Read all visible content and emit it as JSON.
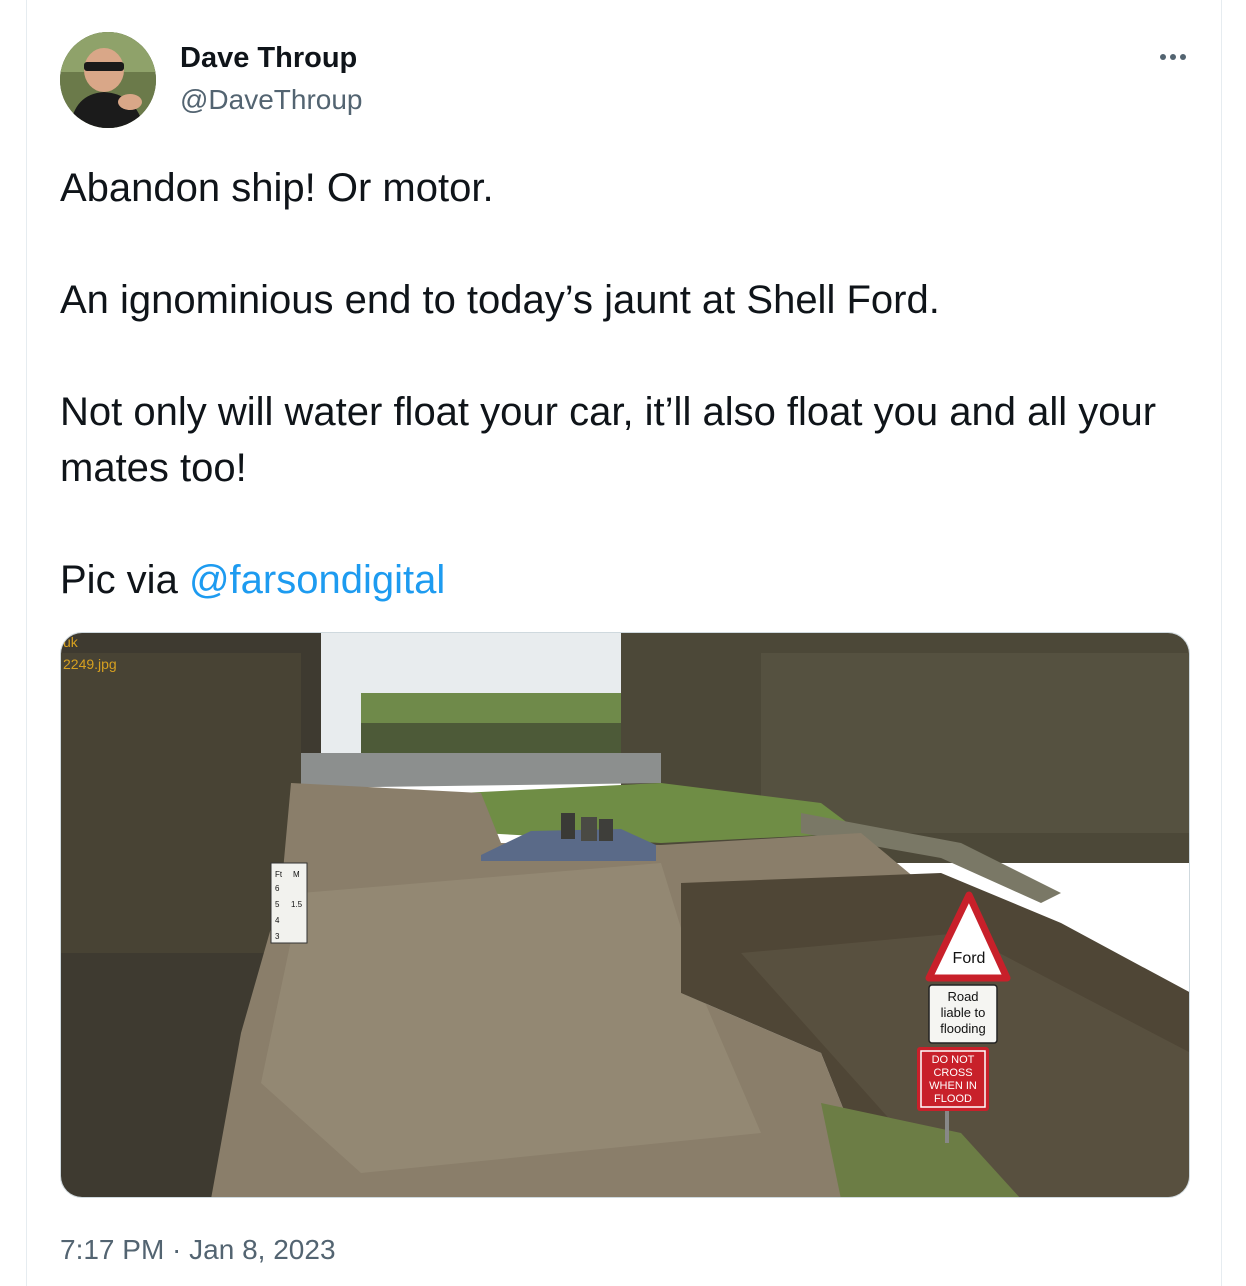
{
  "author": {
    "display_name": "Dave Throup",
    "handle": "@DaveThroup",
    "avatar_icon": "profile-photo"
  },
  "menu_icon": "more-options-icon",
  "tweet": {
    "line1": "Abandon ship! Or motor.",
    "line2": "An ignominious end to today’s jaunt at Shell Ford.",
    "line3": "Not only will water float your car, it’ll also float you and all your mates too!",
    "line4_prefix": "Pic via ",
    "mention": "@farsondigital"
  },
  "media": {
    "overlay_text_1": "uk",
    "overlay_text_2": "2249.jpg",
    "gauge_ft_label": "Ft",
    "gauge_m_label": "M",
    "gauge_marks_ft": [
      "6",
      "5",
      "4",
      "3"
    ],
    "gauge_mark_m": "1.5",
    "sign_ford": "Ford",
    "sign_road": "Road liable to flooding",
    "sign_road_lines": [
      "Road",
      "liable to",
      "flooding"
    ],
    "sign_donot_lines": [
      "DO NOT",
      "CROSS",
      "WHEN IN",
      "FLOOD"
    ]
  },
  "meta": {
    "time": "7:17 PM",
    "separator": " · ",
    "date": "Jan 8, 2023"
  },
  "colors": {
    "link": "#1d9bf0",
    "secondary_text": "#536471",
    "sign_red": "#c8202a"
  }
}
